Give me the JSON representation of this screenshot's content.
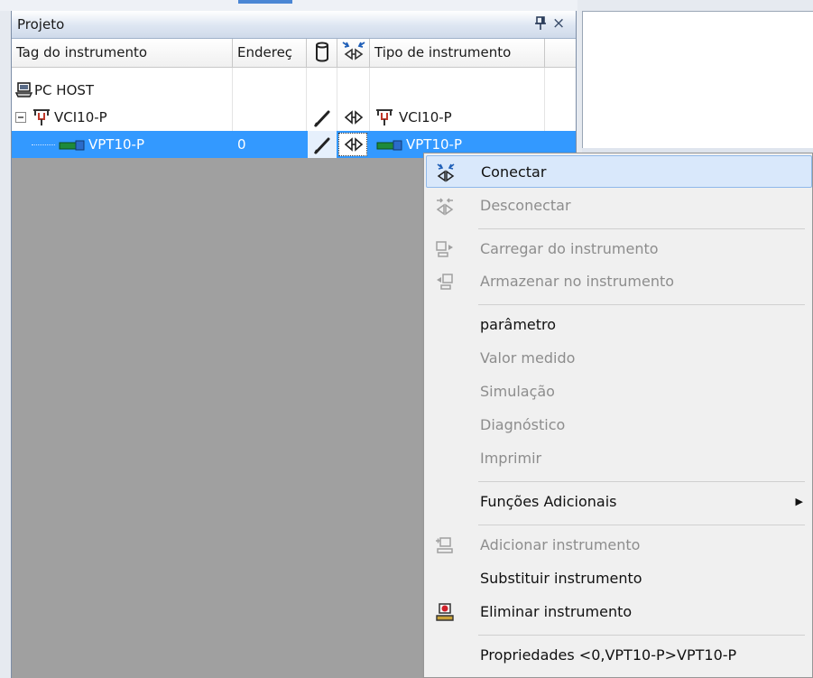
{
  "panel": {
    "title": "Projeto"
  },
  "grid": {
    "headers": {
      "tag": "Tag do instrumento",
      "address": "Endereç",
      "type": "Tipo de instrumento"
    },
    "rows": [
      {
        "tag": "PC HOST",
        "address": "",
        "type": "",
        "icon": "pc-host-icon"
      },
      {
        "tag": "VCI10-P",
        "address": "",
        "type": "VCI10-P",
        "icon": "vci-icon"
      },
      {
        "tag": "VPT10-P",
        "address": "0",
        "type": "VPT10-P",
        "icon": "vpt-icon"
      }
    ],
    "selection_color": "#3399ff"
  },
  "context_menu": {
    "items": [
      {
        "label": "Conectar",
        "state": "enabled",
        "icon": "connect-icon"
      },
      {
        "label": "Desconectar",
        "state": "disabled",
        "icon": "disconnect-icon"
      },
      {
        "label": "Carregar do instrumento",
        "state": "disabled",
        "icon": "upload-icon"
      },
      {
        "label": "Armazenar no instrumento",
        "state": "disabled",
        "icon": "download-icon"
      },
      {
        "label": "parâmetro",
        "state": "enabled"
      },
      {
        "label": "Valor medido",
        "state": "disabled"
      },
      {
        "label": "Simulação",
        "state": "disabled"
      },
      {
        "label": "Diagnóstico",
        "state": "disabled"
      },
      {
        "label": "Imprimir",
        "state": "disabled"
      },
      {
        "label": "Funções Adicionais",
        "state": "enabled",
        "submenu": true
      },
      {
        "label": "Adicionar instrumento",
        "state": "disabled",
        "icon": "add-device-icon"
      },
      {
        "label": "Substituir instrumento",
        "state": "enabled"
      },
      {
        "label": "Eliminar instrumento",
        "state": "enabled",
        "icon": "delete-device-icon"
      },
      {
        "label": "Propriedades <0,VPT10-P>VPT10-P",
        "state": "enabled"
      }
    ]
  },
  "colors": {
    "highlight": "#d9e8fb",
    "disabled_text": "#8d8d8d"
  }
}
